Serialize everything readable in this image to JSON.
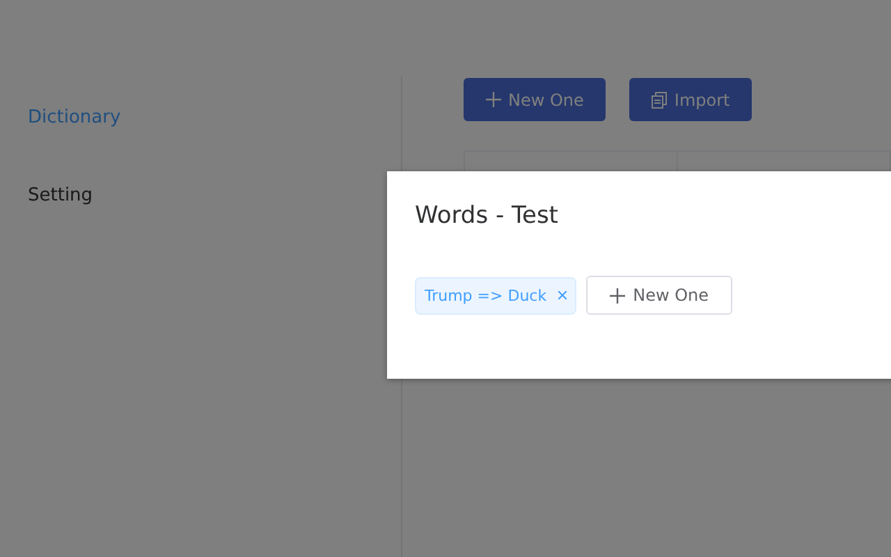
{
  "sidebar": {
    "items": [
      {
        "label": "Dictionary",
        "selected": true
      },
      {
        "label": "Setting",
        "selected": false
      }
    ]
  },
  "toolbar": {
    "buttons": [
      {
        "label": "New One",
        "kind": "plus"
      },
      {
        "label": "Import",
        "kind": "copy"
      }
    ]
  },
  "dialog": {
    "title": "Words - Test",
    "tags": [
      {
        "label": "Trump => Duck"
      }
    ],
    "add_button": "New One"
  }
}
